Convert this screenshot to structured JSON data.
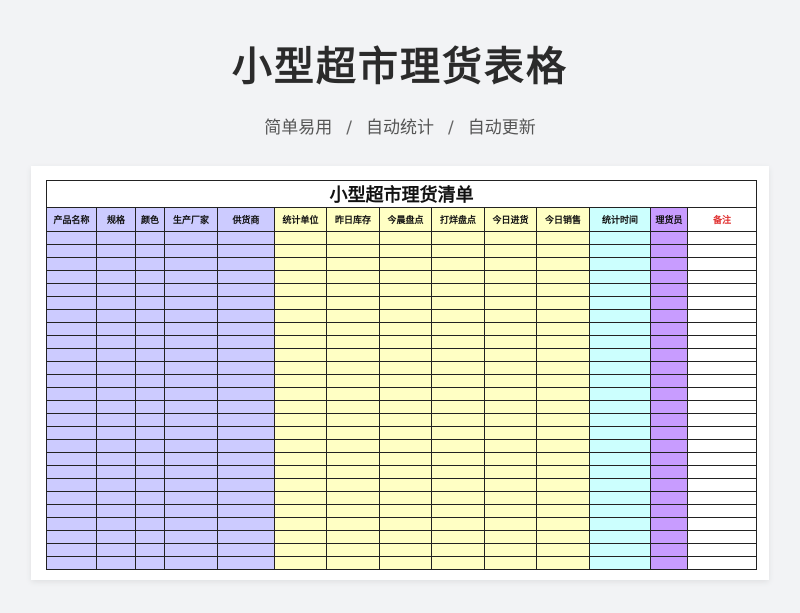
{
  "page": {
    "title": "小型超市理货表格",
    "subtitle_parts": [
      "简单易用",
      "自动统计",
      "自动更新"
    ],
    "subtitle_sep": "/"
  },
  "sheet": {
    "title": "小型超市理货清单",
    "columns": [
      {
        "label": "产品名称",
        "group": "purple"
      },
      {
        "label": "规格",
        "group": "purple"
      },
      {
        "label": "颜色",
        "group": "purple"
      },
      {
        "label": "生产厂家",
        "group": "purple"
      },
      {
        "label": "供货商",
        "group": "purple"
      },
      {
        "label": "统计单位",
        "group": "yellow"
      },
      {
        "label": "昨日库存",
        "group": "yellow"
      },
      {
        "label": "今晨盘点",
        "group": "yellow"
      },
      {
        "label": "打烊盘点",
        "group": "yellow"
      },
      {
        "label": "今日进货",
        "group": "yellow"
      },
      {
        "label": "今日销售",
        "group": "yellow"
      },
      {
        "label": "统计时间",
        "group": "cyan"
      },
      {
        "label": "理货员",
        "group": "violet"
      },
      {
        "label": "备注",
        "group": "white",
        "highlight": true
      }
    ],
    "colors": {
      "purple": "#cccbff",
      "yellow": "#ffffc4",
      "cyan": "#ccfffe",
      "violet": "#c89cff",
      "white": "#ffffff",
      "note_text": "#e03030"
    }
  }
}
